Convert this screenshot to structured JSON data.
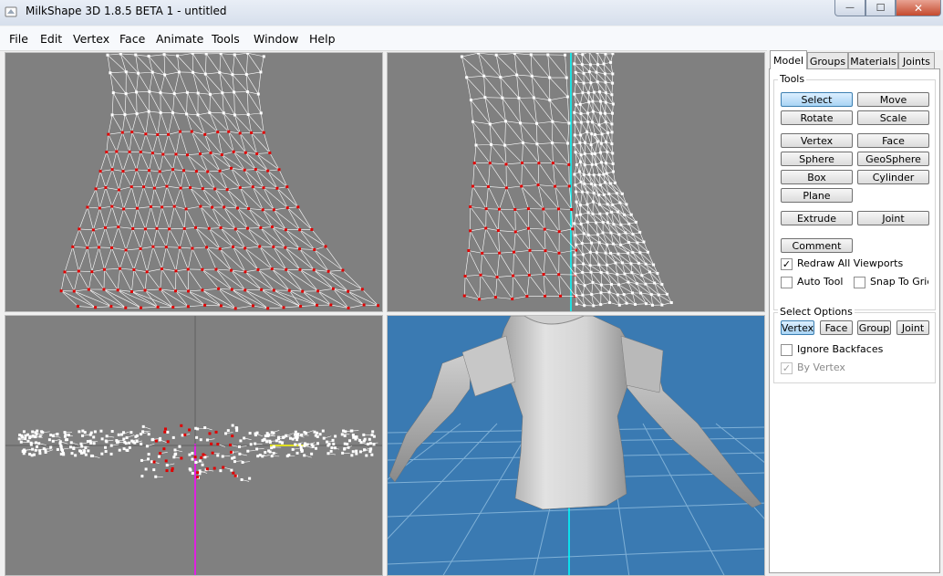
{
  "window": {
    "title": "MilkShape 3D 1.8.5 BETA 1 - untitled",
    "controls": {
      "minimize": "—",
      "maximize": "☐",
      "close": "✕"
    }
  },
  "menu": [
    "File",
    "Edit",
    "Vertex",
    "Face",
    "Animate",
    "Tools",
    "Window",
    "Help"
  ],
  "tabs": [
    "Model",
    "Groups",
    "Materials",
    "Joints"
  ],
  "tools": {
    "title": "Tools",
    "buttons": [
      "Select",
      "Move",
      "Rotate",
      "Scale",
      "Vertex",
      "Face",
      "Sphere",
      "GeoSphere",
      "Box",
      "Cylinder",
      "Plane",
      "Extrude",
      "Joint",
      "Comment"
    ],
    "checkboxes": [
      {
        "label": "Redraw All Viewports",
        "checked": "✓"
      },
      {
        "label": "Auto Tool",
        "checked": ""
      },
      {
        "label": "Snap To Grid",
        "checked": ""
      }
    ]
  },
  "select_options": {
    "title": "Select Options",
    "buttons": [
      "Vertex",
      "Face",
      "Group",
      "Joint"
    ],
    "checkboxes": [
      {
        "label": "Ignore Backfaces",
        "checked": ""
      },
      {
        "label": "By Vertex",
        "checked": "✓"
      }
    ]
  },
  "colors": {
    "viewport_bg": "#808080",
    "viewport_3d_bg": "#3a7ab2",
    "mesh_line": "#ffffff",
    "selected_vertex": "#e00000",
    "axis_x": "#ff00ff",
    "axis_y": "#ffff00",
    "axis_z": "#00ffff",
    "active_button": "#a9d4f4"
  }
}
